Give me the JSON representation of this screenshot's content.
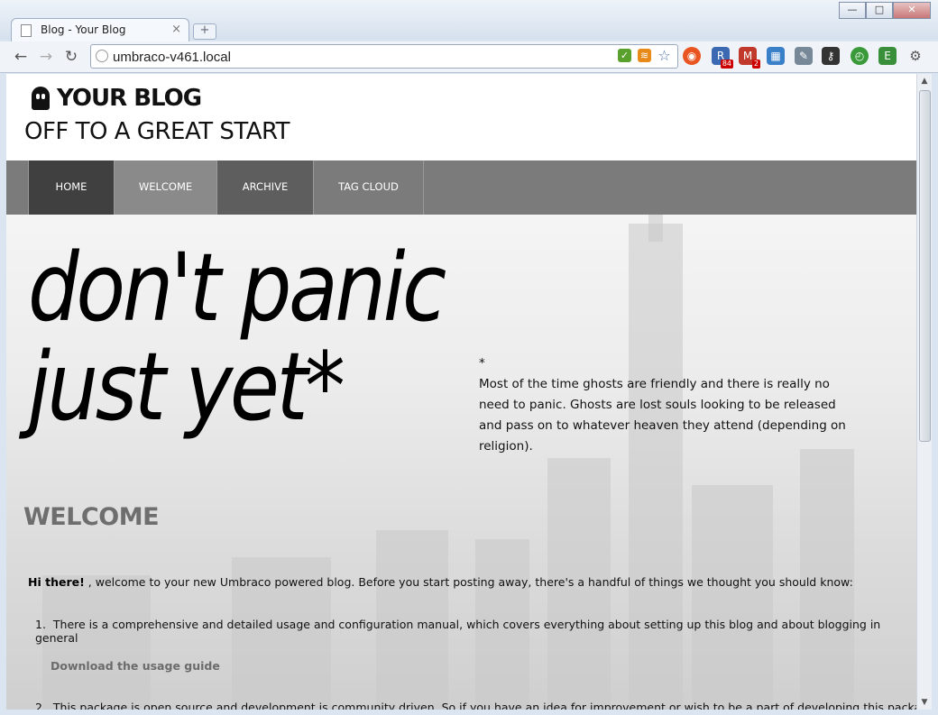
{
  "browser": {
    "tab_title": "Blog - Your Blog",
    "tab_close": "×",
    "new_tab": "+",
    "url": "umbraco-v461.local",
    "back": "←",
    "forward": "→",
    "reload": "↻",
    "min": "—",
    "max": "□",
    "close": "✕",
    "extensions": [
      {
        "name": "rss-icon",
        "glyph": "≋",
        "color": "#e88a1a"
      },
      {
        "name": "bookmark-star-icon",
        "glyph": "☆",
        "color": "#4a6fa5"
      },
      {
        "name": "ubuntu-extension-icon",
        "glyph": "◉",
        "color": "#e95420"
      },
      {
        "name": "reader-extension-icon",
        "glyph": "R",
        "color": "#3b6ab3",
        "badge": "84"
      },
      {
        "name": "gmail-extension-icon",
        "glyph": "M",
        "color": "#c0392b",
        "badge": "2"
      },
      {
        "name": "calendar-icon",
        "glyph": "▦",
        "color": "#3a80c9"
      },
      {
        "name": "eyedropper-icon",
        "glyph": "✎",
        "color": "#567"
      },
      {
        "name": "key-icon",
        "glyph": "⚷",
        "color": "#333"
      },
      {
        "name": "timer-extension-icon",
        "glyph": "◴",
        "color": "#3a9a3a"
      },
      {
        "name": "evernote-icon",
        "glyph": "E",
        "color": "#3a8f3a"
      },
      {
        "name": "wrench-icon",
        "glyph": "🔧",
        "color": "#555"
      }
    ]
  },
  "site": {
    "brand": "YOUR BLOG",
    "tagline": "OFF TO A GREAT START",
    "menu": [
      "HOME",
      "WELCOME",
      "ARCHIVE",
      "TAG CLOUD"
    ],
    "hero_line1": "don't panic",
    "hero_line2": "just yet*",
    "aside_star": "*",
    "aside_text": "Most of the time ghosts are friendly and there is really no need to panic. Ghosts are lost souls looking to be released and pass on to whatever heaven they attend (depending on religion).",
    "welcome_heading": "WELCOME",
    "intro_bold": "Hi there!",
    "intro_rest": " , welcome to your new Umbraco powered blog. Before you start posting away, there's a handful of things we thought you should know:",
    "list": [
      {
        "num": "1.",
        "text": "There is a comprehensive and detailed usage and configuration manual, which covers everything about setting up this blog and about blogging in general"
      },
      {
        "num": "2.",
        "text": "This package is open source and development is community driven. So if you have an idea for improvement or wish to be a part of developing this package you"
      }
    ],
    "download_link": "Download the usage guide"
  }
}
